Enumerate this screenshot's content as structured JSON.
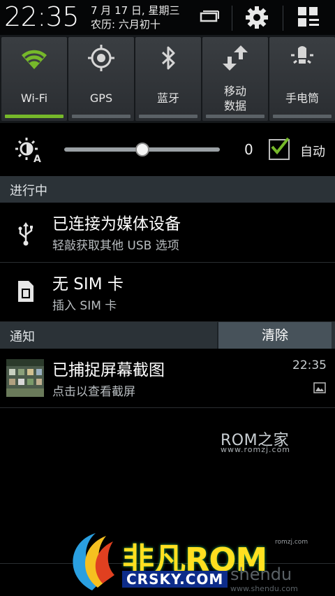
{
  "header": {
    "clock": "22:35",
    "date_line1": "7 月 17 日, 星期三",
    "date_line2": "农历: 六月初十",
    "icons": [
      "recent-apps-icon",
      "settings-gear-icon",
      "grid-menu-icon"
    ]
  },
  "quick_settings": [
    {
      "label": "Wi-Fi",
      "icon": "wifi-icon",
      "on": true
    },
    {
      "label": "GPS",
      "icon": "gps-icon",
      "on": false
    },
    {
      "label": "蓝牙",
      "icon": "bluetooth-icon",
      "on": false
    },
    {
      "label_line1": "移动",
      "label_line2": "数据",
      "icon": "mobile-data-icon",
      "on": false
    },
    {
      "label": "手电筒",
      "icon": "flashlight-icon",
      "on": false
    }
  ],
  "brightness": {
    "value_label": "0",
    "level": 0.5,
    "auto_label": "自动",
    "auto_checked": true
  },
  "ongoing": {
    "title": "进行中",
    "items": [
      {
        "title": "已连接为媒体设备",
        "subtitle": "轻敲获取其他 USB 选项",
        "icon": "usb-icon"
      },
      {
        "title": "无 SIM 卡",
        "subtitle": "插入 SIM 卡",
        "icon": "sim-card-icon"
      }
    ]
  },
  "notifications": {
    "title": "通知",
    "clear_label": "清除",
    "items": [
      {
        "title": "已捕捉屏幕截图",
        "subtitle": "点击以查看截屏",
        "time": "22:35",
        "icon": "screenshot-thumbnail"
      }
    ]
  },
  "watermarks": {
    "romzj": "ROM之家",
    "romzj_url": "www.romzj.com",
    "brand": "非凡ROM",
    "domain": "CRSKY.COM",
    "shendu": "shendu",
    "shendu_url": "www.shendu.com",
    "romzj_small": "romzj.com"
  },
  "colors": {
    "accent_green": "#76b82a",
    "section_bg": "#2b3237",
    "tile_bg": "#3a3e42"
  }
}
